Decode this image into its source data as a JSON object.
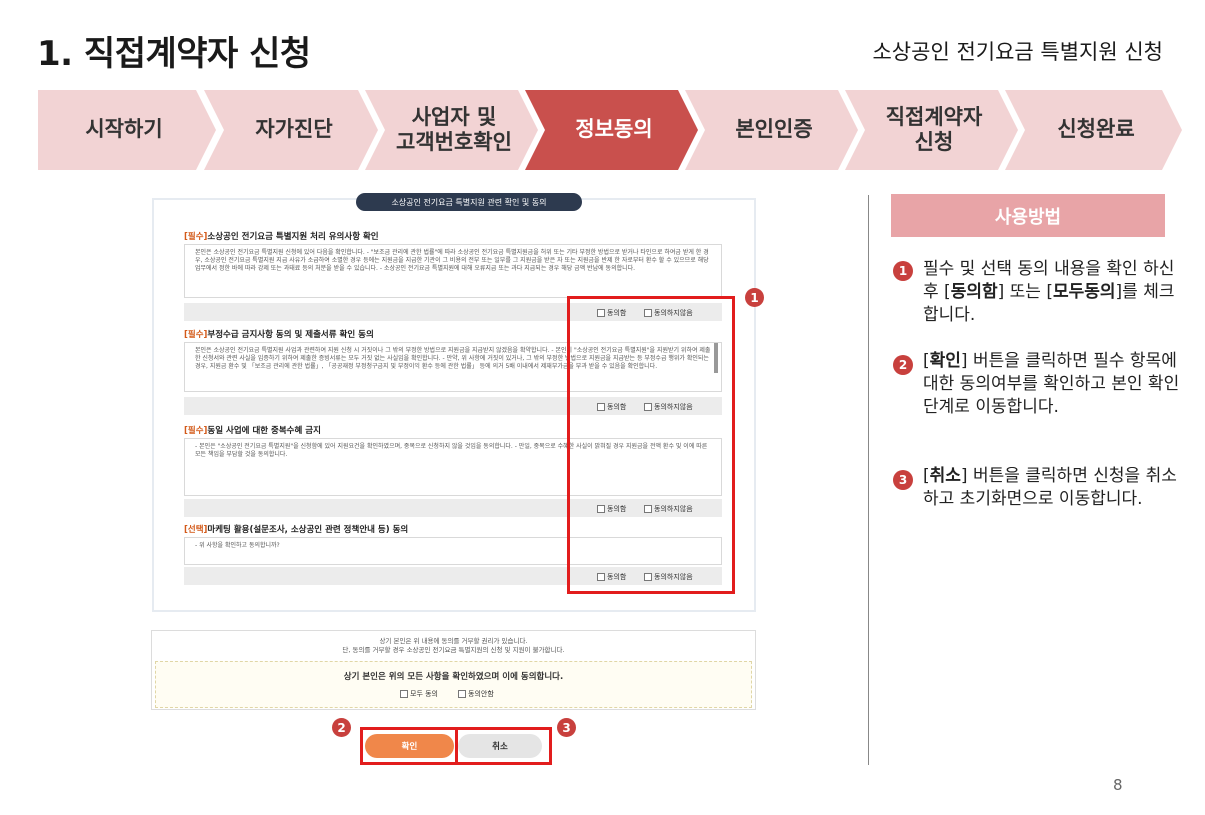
{
  "header": {
    "title": "1. 직접계약자 신청",
    "subtitle": "소상공인 전기요금 특별지원 신청"
  },
  "steps": [
    {
      "line1": "시작하기",
      "line2": ""
    },
    {
      "line1": "자가진단",
      "line2": ""
    },
    {
      "line1": "사업자 및",
      "line2": "고객번호확인"
    },
    {
      "line1": "정보동의",
      "line2": ""
    },
    {
      "line1": "본인인증",
      "line2": ""
    },
    {
      "line1": "직접계약자",
      "line2": "신청"
    },
    {
      "line1": "신청완료",
      "line2": ""
    }
  ],
  "colors": {
    "step_inactive": "#f2d3d4",
    "step_active": "#c9504d",
    "accent_red": "#c8403d",
    "highlight_box": "#e21d1d",
    "confirm_button": "#f0874a"
  },
  "consent_form": {
    "title": "소상공인 전기요금 특별지원 관련 확인 및 동의",
    "sections": [
      {
        "tag": "[필수]",
        "heading": "소상공인 전기요금 특별지원 처리 유의사항 확인",
        "body": "본인은 소상공인 전기요금 특별지원 신청에 있어 다음을 확인합니다. - \"보조금 관리에 관한 법률\"에 따라 소상공인 전기요금 특별지원금을 허위 또는 기타 부정한 방법으로 받거나 타인으로 하여금 받게 한 경우, 소상공인 전기요금 특별지원 지급 사유가 소급하여 소멸한 경우 등에는 지원금을 지급한 기관이 그 비용의 전부 또는 일부를 그 지원금을 받은 자 또는 지원금을 반제 한 자로부터 환수 할 수 있으므로 해당 업무에서 정한 바에 따라 강제 또는 과태료 등의 처분을 받을 수 있습니다. - 소상공인 전기요금 특별지원에 대해 오류지급 또는 과다 지급되는 경우 해당 금액 반납에 동의합니다.",
        "agree": "동의함",
        "disagree": "동의하지않음"
      },
      {
        "tag": "[필수]",
        "heading": "부정수급 금지사항 동의 및 제출서류 확인 동의",
        "body": "본인은 소상공인 전기요금 특별지원 사업과 관련하여 지원 신청 시 거짓이나 그 밖의 부정한 방법으로 지원금을 지급받지 않겠음을 확약합니다. - 본인이 \"소상공인 전기요금 특별지원\"을 지원받기 위하여 제출한 신청서와 관련 사실을 입증하기 위하여 제출한 증빙서류는 모두 거짓 없는 사실임을 확인합니다. - 만약, 위 사항에 거짓이 있거나, 그 밖의 부정한 방법으로 지원금을 지급받는 등 부정수급 행위가 확인되는 경우, 지원금 환수 및 「보조금 관리에 관한 법률」, 「공공재정 부정청구금지 및 부정이익 환수 등에 관한 법률」 등에 의거 5배 이내에서 제재부가금을 부과 받을 수 있음을 확인합니다.",
        "agree": "동의함",
        "disagree": "동의하지않음"
      },
      {
        "tag": "[필수]",
        "heading": "동일 사업에 대한 중복수혜 금지",
        "body": "- 본인은 \"소상공인 전기요금 특별지원\"을 신청함에 있어 지원요건을 확인하였으며, 중복으로 신청하지 않을 것임을 동의합니다. - 만일, 중복으로 수혜한 사실이 밝혀질 경우 지원금을 전액 환수 및 이에 따른 모든 책임을 부담할 것을 동의합니다.",
        "agree": "동의함",
        "disagree": "동의하지않음"
      },
      {
        "tag": "[선택]",
        "heading": "마케팅 활용(설문조사, 소상공인 관련 정책안내 등) 동의",
        "body": "- 위 사항을 확인하고 동의합니까?",
        "agree": "동의함",
        "disagree": "동의하지않음"
      }
    ],
    "notice_line1": "상기 본인은 위 내용에 동의를 거부할 권리가 있습니다.",
    "notice_line2": "단, 동의를 거부할 경우 소상공인 전기요금 특별지원의 신청 및 지원이 불가합니다.",
    "confirm_text": "상기 본인은 위의 모든 사항을 확인하였으며 이에 동의합니다.",
    "agree_all": "모두 동의",
    "agree_partial": "동의안함",
    "confirm_button": "확인",
    "cancel_button": "취소"
  },
  "markers": [
    "1",
    "2",
    "3"
  ],
  "sidebar": {
    "header": "사용방법",
    "instructions": [
      {
        "num": "1",
        "pre": "필수 및 선택 동의 내용을 확인 하신 후 [",
        "b1": "동의함",
        "mid": "] 또는 [",
        "b2": "모두동의",
        "post": "]를 체크합니다."
      },
      {
        "num": "2",
        "pre": "[",
        "b1": "확인",
        "post": "] 버튼을 클릭하면 필수 항목에 대한 동의여부를 확인하고 본인 확인 단계로 이동합니다."
      },
      {
        "num": "3",
        "pre": "[",
        "b1": "취소",
        "post": "] 버튼을 클릭하면 신청을 취소하고 초기화면으로 이동합니다."
      }
    ]
  },
  "page_number": "8"
}
